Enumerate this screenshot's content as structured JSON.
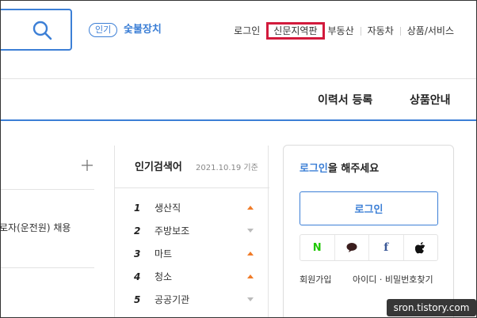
{
  "header": {
    "popular_tag": "인기",
    "popular_keyword": "숯불장치",
    "links": {
      "login": "로그인",
      "newspaper": "신문지역판",
      "realestate": "부동산",
      "car": "자동차",
      "products_services": "상품/서비스"
    },
    "highlight_color": "#d21a3c",
    "accent_color": "#3c7fd6"
  },
  "nav": {
    "resume_register": "이력서 등록",
    "product_info": "상품안내"
  },
  "left_panel": {
    "job_snippet": "로자(운전원) 채용"
  },
  "popular_keywords": {
    "title": "인기검색어",
    "date": "2021.10.19 기준",
    "items": [
      {
        "rank": "1",
        "keyword": "생산직",
        "trend": "up"
      },
      {
        "rank": "2",
        "keyword": "주방보조",
        "trend": "down"
      },
      {
        "rank": "3",
        "keyword": "마트",
        "trend": "up"
      },
      {
        "rank": "4",
        "keyword": "청소",
        "trend": "up"
      },
      {
        "rank": "5",
        "keyword": "공공기관",
        "trend": "down"
      }
    ]
  },
  "login_box": {
    "prompt_link": "로그인",
    "prompt_rest": "을 해주세요",
    "button_label": "로그인",
    "social": [
      "naver-icon",
      "kakao-talk-icon",
      "facebook-icon",
      "apple-icon"
    ],
    "naver_glyph": "N",
    "facebook_glyph": "f",
    "signup": "회원가입",
    "find_account": "아이디 · 비밀번호찾기"
  },
  "watermark": "sron.tistory.com"
}
